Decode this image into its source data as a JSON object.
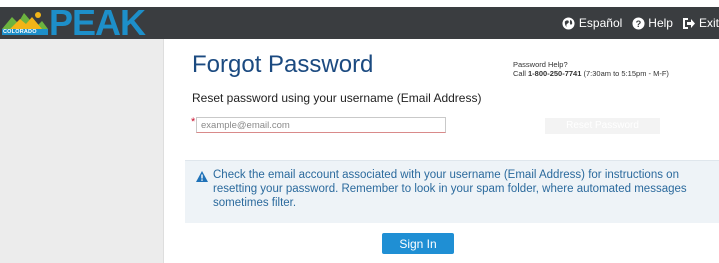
{
  "header": {
    "logo_small_text": "COLORADO",
    "logo_text": "PEAK",
    "nav": [
      {
        "label": "Español",
        "icon": "globe-icon"
      },
      {
        "label": "Help",
        "icon": "question-circle-icon"
      },
      {
        "label": "Exit",
        "icon": "sign-out-icon"
      }
    ]
  },
  "page": {
    "title": "Forgot Password",
    "help_line1": "Password Help?",
    "help_prefix": "Call ",
    "help_phone": "1-800-250-7741",
    "help_hours": " (7:30am to 5:15pm - M-F)",
    "subtitle": "Reset password using your username (Email Address)",
    "required_marker": "*",
    "email_placeholder": "example@email.com",
    "email_value": "",
    "submit_label": "Reset Password",
    "info_icon": "warning-triangle-icon",
    "info_text": "Check the email account associated with your username (Email Address) for instructions on resetting your password. Remember to look in your spam folder, where automated messages sometimes filter.",
    "signin_label": "Sign In"
  },
  "colors": {
    "header_bg": "#3a3d40",
    "brand_blue": "#1d8fc9",
    "title_blue": "#1b4a80",
    "button_blue": "#1f8fd4",
    "info_bg": "#eef3f7",
    "info_text": "#2b6a9d"
  }
}
